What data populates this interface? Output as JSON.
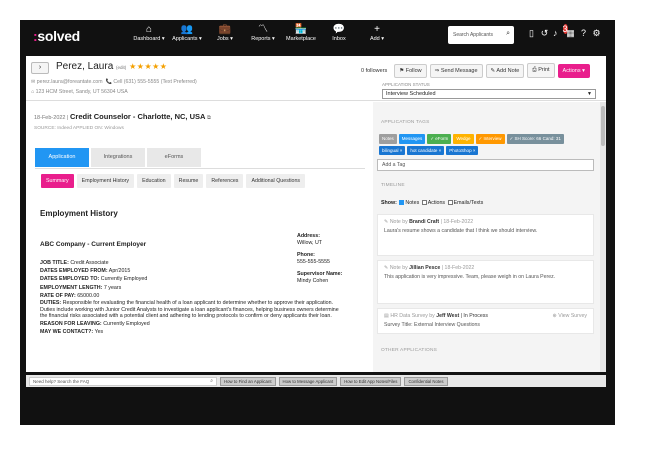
{
  "brand": {
    "logo_prefix": ":",
    "logo_text": "solved"
  },
  "nav": [
    {
      "label": "Dashboard ▾",
      "icon": "⌂"
    },
    {
      "label": "Applicants ▾",
      "icon": "👥"
    },
    {
      "label": "Jobs ▾",
      "icon": "💼"
    },
    {
      "label": "Reports ▾",
      "icon": "〽"
    },
    {
      "label": "Marketplace",
      "icon": "🏪"
    },
    {
      "label": "Inbox",
      "icon": "💬"
    },
    {
      "label": "Add ▾",
      "icon": "+"
    }
  ],
  "search": {
    "placeholder": "Search Applicants"
  },
  "notifications": {
    "count": "3"
  },
  "candidate": {
    "name": "Perez, Laura",
    "edit": "(edit)",
    "stars": "★★★★★",
    "email": "perez.laura@foreantate.com",
    "cell": "Cell (631) 555-5555 (Text Preferred)",
    "address": "123 HCM Street, Sandy, UT 56304 USA"
  },
  "actions": {
    "followers": "0 followers",
    "follow": "Follow",
    "send_message": "Send Message",
    "add_note": "Add Note",
    "print": "Print",
    "actions": "Actions ▾"
  },
  "status": {
    "label": "APPLICATION STATUS",
    "value": "Interview Scheduled"
  },
  "job": {
    "date": "18-Feb-2022 |",
    "title": "Credit Counselor - Charlotte, NC, USA",
    "source": "SOURCE: Indeed APPLIED ON: Windows"
  },
  "tabs": [
    "Application",
    "Integrations",
    "eForms"
  ],
  "subtabs": [
    "Summary",
    "Employment History",
    "Education",
    "Resume",
    "References",
    "Additional Questions"
  ],
  "employment": {
    "heading": "Employment History",
    "company": "ABC Company - Current Employer",
    "job_title_label": "JOB TITLE:",
    "job_title": "Credit Associate",
    "from_label": "DATES EMPLOYED FROM:",
    "from": "Apr/2015",
    "to_label": "DATES EMPLOYED TO:",
    "to": "Currently Employed",
    "length_label": "EMPLOYMENT LENGTH:",
    "length": "7 years",
    "rate_label": "RATE OF PAY:",
    "rate": "65000.00",
    "duties_label": "DUTIES:",
    "duties": "Responsible for evaluating the financial health of a loan applicant to determine whether to approve their application. Duties include working with Junior Credit Analysts to investigate a loan applicant's finances, helping business owners determine the financial risks associated with a potential client and adhering to lending protocols to confirm or deny applicants their loan.",
    "reason_label": "REASON FOR LEAVING:",
    "reason": "Currently Employed",
    "contact_label": "MAY WE CONTACT?:",
    "contact": "Yes",
    "address_label": "Address:",
    "address": "Willow, UT",
    "phone_label": "Phone:",
    "phone": "555-555-5555",
    "supervisor_label": "Supervisor Name:",
    "supervisor": "Mindy Cohen"
  },
  "right": {
    "tags_label": "APPLICATION TAGS",
    "tags": [
      {
        "text": "Notes",
        "color": "#9e9e9e"
      },
      {
        "text": "Messages",
        "color": "#2196f3"
      },
      {
        "text": "✓ eForm",
        "color": "#4caf50"
      },
      {
        "text": "Wedge",
        "color": "#ffb300"
      },
      {
        "text": "✓ Interview",
        "color": "#ff9800"
      },
      {
        "text": "✓ SH Score: 66 Cand: 31",
        "color": "#78909c"
      },
      {
        "text": "bilingual ×",
        "color": "#1976d2"
      },
      {
        "text": "hot candidate ×",
        "color": "#1976d2"
      },
      {
        "text": "PhotoShop ×",
        "color": "#1976d2"
      }
    ],
    "add_tag": "Add a Tag",
    "timeline_label": "TIMELINE",
    "show_label": "Show:",
    "f_notes": "Notes",
    "f_actions": "Actions",
    "f_emails": "Emails/Texts",
    "note1": {
      "prefix": "Note by",
      "author": "Brandi Craft",
      "date": "| 18-Feb-2022",
      "text": "Laura's resume shows a candidate that I think we should interview."
    },
    "note2": {
      "prefix": "Note by",
      "author": "Jillian Pesce",
      "date": "| 18-Feb-2022",
      "text": "This application is very impressive. Team, please weigh in on Laura Perez."
    },
    "survey": {
      "prefix": "HR Data Survey by",
      "author": "Jeff West",
      "state": "| In Process",
      "view": "View Survey",
      "title_label": "Survey Title:",
      "title": "External Interview Questions"
    },
    "other_label": "OTHER APPLICATIONS"
  },
  "footer": {
    "help_placeholder": "Need help? Search the FAQ",
    "links": [
      "How to Find an Applicant",
      "How to Message Applicant",
      "How to Edit App Notes/Files",
      "Confidential Notes"
    ]
  }
}
